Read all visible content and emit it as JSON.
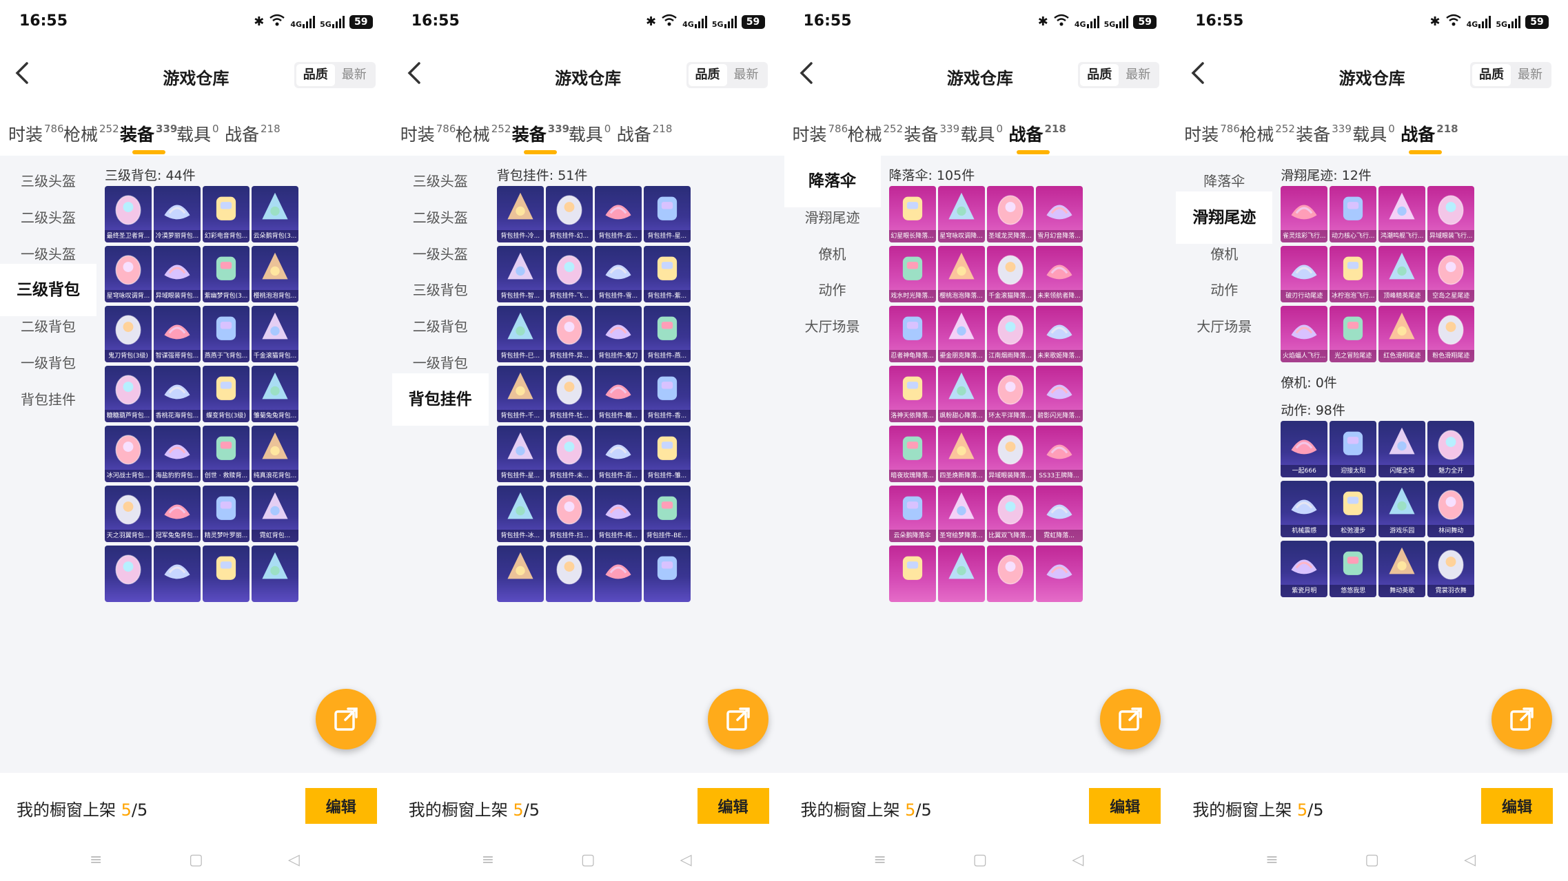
{
  "status": {
    "time": "16:55",
    "network": "4G",
    "network2": "5G",
    "battery": "59"
  },
  "header": {
    "title": "游戏仓库",
    "sort_quality": "品质",
    "sort_latest": "最新"
  },
  "tabs": [
    {
      "label": "时装",
      "count": "786"
    },
    {
      "label": "枪械",
      "count": "252"
    },
    {
      "label": "装备",
      "count": "339"
    },
    {
      "label": "载具",
      "count": "0"
    },
    {
      "label": "战备",
      "count": "218"
    }
  ],
  "equip_sidebar": [
    "三级头盔",
    "二级头盔",
    "一级头盔",
    "三级背包",
    "二级背包",
    "一级背包",
    "背包挂件"
  ],
  "gear_sidebar": [
    "降落伞",
    "滑翔尾迹",
    "僚机",
    "动作",
    "大厅场景"
  ],
  "shelf": {
    "label": "我的橱窗上架",
    "current": "5",
    "total": "/5",
    "edit": "编辑"
  },
  "panels": [
    {
      "active_tab": 2,
      "sidebar_type": "equip",
      "active_side": 3,
      "sections": [
        {
          "title": "三级背包: 44件",
          "color": "blue",
          "items": [
            "最终圣卫者背...",
            "冷漠萝丽背包...",
            "幻彩电音背包...",
            "云朵鹅背包(3...",
            "星穹咏叹调背...",
            "异域眼装背包...",
            "紫幽梦背包(3...",
            "樱桃泡泡背包...",
            "鬼刀背包(3级)",
            "智谋强哥背包...",
            "燕燕于飞背包...",
            "千金滚猫背包...",
            "糖糖葫芦背包...",
            "香桃花海背包...",
            "蝶变背包(3级)",
            "雏菊兔兔背包...",
            "冰河战士背包...",
            "海盐豹豹背包...",
            "创世 · 救赎背...",
            "纯真浪花背包...",
            "天之羽翼背包...",
            "冠军兔兔背包...",
            "精灵梦叶罗丽...",
            "霓虹背包...",
            "",
            "",
            "",
            ""
          ]
        }
      ]
    },
    {
      "active_tab": 2,
      "sidebar_type": "equip",
      "active_side": 6,
      "sections": [
        {
          "title": "背包挂件: 51件",
          "color": "blue",
          "items": [
            "背包挂件-冷...",
            "背包挂件-幻...",
            "背包挂件-云...",
            "背包挂件-星...",
            "背包挂件-智...",
            "背包挂件-飞...",
            "背包挂件-雪...",
            "背包挂件-紫...",
            "背包挂件-巳...",
            "背包挂件-异...",
            "背包挂件-鬼刀",
            "背包挂件-燕...",
            "背包挂件-千...",
            "背包挂件-牡...",
            "背包挂件-糖...",
            "背包挂件-香...",
            "背包挂件-星...",
            "背包挂件-未...",
            "背包挂件-百...",
            "背包挂件-雏...",
            "背包挂件-冰...",
            "背包挂件-扫...",
            "背包挂件-纯...",
            "背包挂件-BE...",
            "",
            "",
            "",
            ""
          ]
        }
      ]
    },
    {
      "active_tab": 4,
      "sidebar_type": "gear",
      "active_side": 0,
      "sections": [
        {
          "title": "降落伞: 105件",
          "color": "pink",
          "items": [
            "幻星眼长降落...",
            "星穹咏叹调降...",
            "圣域龙灵降落...",
            "雪月幻音降落...",
            "戏水时光降落...",
            "樱桃泡泡降落...",
            "千金滚猫降落...",
            "未来领航者降...",
            "忍者神龟降落...",
            "鎏金朋克降落...",
            "江南烟雨降落...",
            "未来歌姬降落...",
            "洛神天依降落...",
            "飒粉甜心降落...",
            "环太平洋降落...",
            "碧影闪光降落...",
            "暗夜玫瑰降落...",
            "四圣焕新降落...",
            "异域眼装降落...",
            "SS33王牌降...",
            "云朵鹅降落伞",
            "圣穹绘梦降落...",
            "比翼双飞降落...",
            "霓虹降落...",
            "",
            "",
            "",
            ""
          ]
        }
      ]
    },
    {
      "active_tab": 4,
      "sidebar_type": "gear",
      "active_side": 1,
      "sections": [
        {
          "title": "滑翔尾迹: 12件",
          "color": "pink",
          "items": [
            "雀灵炫彩飞行...",
            "动力核心飞行...",
            "鸿潮鸣舰飞行...",
            "异域眼装飞行...",
            "破刃行动尾迹",
            "冰柠泡泡飞行...",
            "顶峰精英尾迹",
            "空岛之星尾迹",
            "火焰蝠人飞行...",
            "光之冒险尾迹",
            "红色滑翔尾迹",
            "粉色滑翔尾迹"
          ]
        },
        {
          "title": "僚机: 0件",
          "color": "blue",
          "items": []
        },
        {
          "title": "动作: 98件",
          "color": "blue",
          "items": [
            "一起666",
            "迎接太阳",
            "闪耀全场",
            "魅力全开",
            "机械震感",
            "松弛漫步",
            "游戏乐园",
            "林间舞动",
            "紫瓷月明",
            "悠悠我思",
            "舞动英歌",
            "霓裳羽衣舞"
          ]
        }
      ]
    }
  ],
  "colors": {
    "accent": "#ffb300",
    "edit_bg": "#ffb800",
    "card_blue": "#3a3592",
    "card_pink": "#d54cb6"
  },
  "icons": {
    "share": "share-out-icon",
    "back": "chevron-left-icon"
  }
}
